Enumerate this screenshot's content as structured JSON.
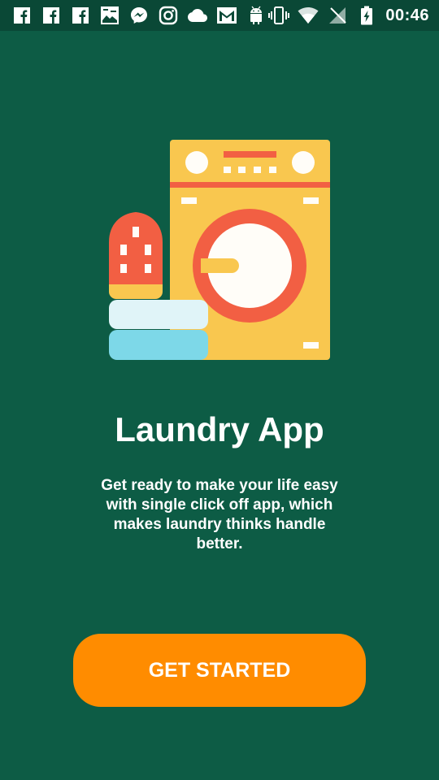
{
  "status_bar": {
    "time": "00:46",
    "left_icons": [
      "facebook-icon",
      "facebook-icon",
      "facebook-icon",
      "photo-icon",
      "messenger-icon",
      "instagram-icon",
      "cloud-icon",
      "gmail-icon",
      "android-icon"
    ],
    "right_icons": [
      "vibrate-icon",
      "wifi-icon",
      "no-signal-icon",
      "battery-charging-icon"
    ]
  },
  "colors": {
    "background": "#0d5c45",
    "status_bar": "#0a4836",
    "button": "#ff8c00",
    "machine_body": "#f9c74f",
    "accent_red": "#f25f43",
    "towel_light": "#e0f4f8",
    "towel_blue": "#7dd8e8"
  },
  "illustration": {
    "description": "laundry-illustration"
  },
  "welcome": {
    "title": "Laundry App",
    "description": "Get ready to make your life easy with single click off app, which makes laundry thinks handle better.",
    "button_label": "GET STARTED"
  }
}
